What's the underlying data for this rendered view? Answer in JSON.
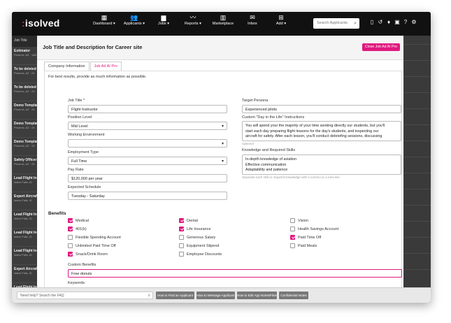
{
  "app": {
    "logo_text": "isolved",
    "accent_color": "#e0197e"
  },
  "nav": [
    {
      "label": "Dashboard ▾",
      "icon": "dashboard-icon"
    },
    {
      "label": "Applicants ▾",
      "icon": "people-icon"
    },
    {
      "label": "Jobs ▾",
      "icon": "briefcase-icon"
    },
    {
      "label": "Reports ▾",
      "icon": "chart-icon"
    },
    {
      "label": "Marketplace",
      "icon": "store-icon"
    },
    {
      "label": "Inbox",
      "icon": "inbox-icon"
    },
    {
      "label": "Add ▾",
      "icon": "add-icon"
    }
  ],
  "search": {
    "placeholder": "Search Applicants"
  },
  "top_icons": [
    "bookmark-icon",
    "history-icon",
    "notification-icon",
    "calendar-icon",
    "help-icon",
    "gear-icon"
  ],
  "sidebar": {
    "header": "Job Title",
    "items": [
      {
        "title": "Estimator",
        "sub": "Phoenix, AZ · 188"
      },
      {
        "title": "To be deleted",
        "sub": "Phoenix, AZ · 24"
      },
      {
        "title": "To be deleted",
        "sub": "Phoenix, AZ · 24"
      },
      {
        "title": "Demo Templat",
        "sub": "Phoenix, AZ · 24"
      },
      {
        "title": "Demo Templat",
        "sub": "Phoenix, AZ · 24"
      },
      {
        "title": "Demo Templat",
        "sub": "Phoenix, AZ · 24"
      },
      {
        "title": "Safety Officer",
        "sub": "Phoenix, AZ · 24"
      },
      {
        "title": "Lead Flight In",
        "sub": "Idaho Falls, ID"
      },
      {
        "title": "Expert Aircraf",
        "sub": "Idaho Falls, ID"
      },
      {
        "title": "Lead Flight In",
        "sub": "Idaho Falls, ID"
      },
      {
        "title": "Lead Flight In",
        "sub": "Idaho Falls, ID"
      },
      {
        "title": "Lead Flight In",
        "sub": "Idaho Falls, ID"
      },
      {
        "title": "Expert Aircraf",
        "sub": "Idaho Falls, ID"
      },
      {
        "title": "Lead Flight In",
        "sub": "Idaho Falls, ID"
      },
      {
        "title": "Expert Aircraf",
        "sub": "Idaho Falls, ID"
      },
      {
        "title": "Lead Flight In",
        "sub": "Idaho Falls, ID"
      }
    ]
  },
  "modal": {
    "title": "Job Title and Description for Career site",
    "close_label": "Close Job Ad AI Pro",
    "tabs": [
      "Company Information",
      "Job Ad AI Pro"
    ],
    "hint": "For best results, provide as much information as possible.",
    "job_title": {
      "label": "Job Title *",
      "value": "Flight Instructor"
    },
    "position_level": {
      "label": "Position Level",
      "value": "Mid Level"
    },
    "working_environment": {
      "label": "Working Environment",
      "value": ""
    },
    "employment_type": {
      "label": "Employment Type",
      "value": "Full Time"
    },
    "pay_rate": {
      "label": "Pay Rate",
      "value": "$120,000 per year"
    },
    "expected_schedule": {
      "label": "Expected Schedule",
      "value": "Tuesday - Saturday"
    },
    "target_persona": {
      "label": "Target Persona",
      "value": "Experienced pilots"
    },
    "day_in_life": {
      "label": "Custom \"Day in the Life\" Instructions",
      "lines": [
        "You will spend your the majority of your time working directly our students, but you'll",
        "start each day preparing flight lessons for the day's students, and inspecting our",
        "aircraft for safety. After each lesson, you'll conduct debriefing sessions, discussing"
      ],
      "optional": "Optional"
    },
    "knowledge": {
      "label": "Knowledge and Required Skills",
      "lines": [
        "In-depth knowledge of aviation",
        "Effective communication",
        "Adaptability and patience"
      ],
      "hint": "Separate each skill or required knowledge with a comma or a new line."
    },
    "benefits_title": "Benefits",
    "benefits": [
      {
        "label": "Medical",
        "checked": true
      },
      {
        "label": "Dental",
        "checked": true
      },
      {
        "label": "Vision",
        "checked": false
      },
      {
        "label": "401(k)",
        "checked": true
      },
      {
        "label": "Life Insurance",
        "checked": true
      },
      {
        "label": "Health Savings Account",
        "checked": false
      },
      {
        "label": "Flexible Spending Account",
        "checked": false
      },
      {
        "label": "Generous Salary",
        "checked": false
      },
      {
        "label": "Paid Time Off",
        "checked": true
      },
      {
        "label": "Unlimited Paid Time Off",
        "checked": false
      },
      {
        "label": "Equipment Stipend",
        "checked": false
      },
      {
        "label": "Paid Meals",
        "checked": false
      },
      {
        "label": "Snack/Drink Room",
        "checked": true
      },
      {
        "label": "Employee Discounts",
        "checked": false
      }
    ],
    "custom_benefits": {
      "label": "Custom Benefits",
      "value": "Free donuts"
    },
    "keywords": {
      "label": "Keywords"
    }
  },
  "footer": {
    "help_placeholder": "Need help? Search the FAQ",
    "buttons": [
      "How to Find an Applicant",
      "How to Message Applicant",
      "How to Edit App Notes/Files",
      "Confidential Notes"
    ]
  }
}
